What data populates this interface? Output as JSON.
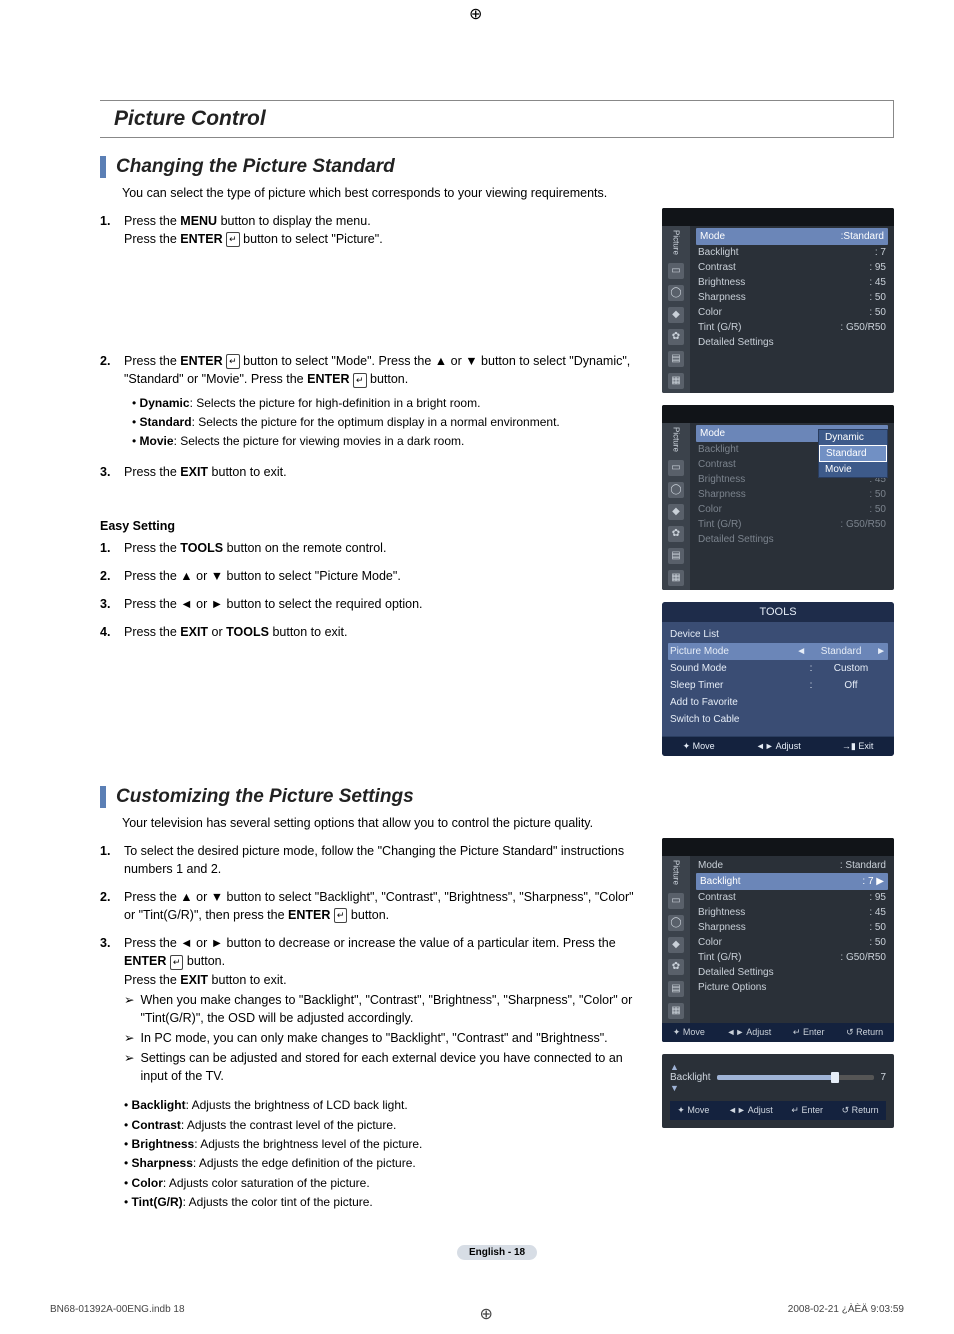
{
  "section_title": "Picture Control",
  "sub1": {
    "title": "Changing the Picture Standard",
    "intro": "You can select the type of picture which best corresponds to your viewing requirements.",
    "steps": {
      "s1a": "Press the ",
      "s1b": "MENU",
      "s1c": " button to display the menu.",
      "s1d": "Press the ",
      "s1e": "ENTER",
      "s1f": " button to select \"Picture\".",
      "s2a": "Press the ",
      "s2b": "ENTER",
      "s2c": " button to select \"Mode\". Press the ▲ or ▼ button to select \"Dynamic\", \"Standard\" or \"Movie\". Press the ",
      "s2d": "ENTER",
      "s2e": " button.",
      "dyn_l": "Dynamic",
      "dyn_d": ": Selects the picture for high-definition in a bright room.",
      "std_l": "Standard",
      "std_d": ": Selects the picture for the optimum display in a normal environment.",
      "mov_l": "Movie",
      "mov_d": ": Selects the picture for viewing movies in a dark room.",
      "s3a": "Press the ",
      "s3b": "EXIT",
      "s3c": " button to exit."
    },
    "easy_title": "Easy Setting",
    "easy": {
      "e1a": "Press the ",
      "e1b": "TOOLS",
      "e1c": " button on the remote control.",
      "e2": "Press the ▲ or ▼ button to select \"Picture Mode\".",
      "e3": "Press the ◄ or ► button to select the required option.",
      "e4a": "Press the ",
      "e4b": "EXIT",
      "e4c": " or ",
      "e4d": "TOOLS",
      "e4e": " button to exit."
    }
  },
  "osd1": {
    "side": "Picture",
    "rows": [
      {
        "k": "Mode",
        "v": ":Standard",
        "hl": true
      },
      {
        "k": "Backlight",
        "v": ": 7"
      },
      {
        "k": "Contrast",
        "v": ": 95"
      },
      {
        "k": "Brightness",
        "v": ": 45"
      },
      {
        "k": "Sharpness",
        "v": ": 50"
      },
      {
        "k": "Color",
        "v": ": 50"
      },
      {
        "k": "Tint (G/R)",
        "v": ": G50/R50"
      },
      {
        "k": "Detailed Settings",
        "v": ""
      }
    ]
  },
  "osd2": {
    "side": "Picture",
    "rows": [
      {
        "k": "Mode",
        "v": "",
        "hl": true
      },
      {
        "k": "Backlight",
        "v": ""
      },
      {
        "k": "Contrast",
        "v": ""
      },
      {
        "k": "Brightness",
        "v": ": 45"
      },
      {
        "k": "Sharpness",
        "v": ": 50"
      },
      {
        "k": "Color",
        "v": ": 50"
      },
      {
        "k": "Tint (G/R)",
        "v": ": G50/R50"
      },
      {
        "k": "Detailed Settings",
        "v": ""
      }
    ],
    "popup": [
      "Dynamic",
      "Standard",
      "Movie"
    ],
    "popup_selected": "Standard"
  },
  "tools": {
    "title": "TOOLS",
    "rows": [
      {
        "k": "Device List",
        "v": "",
        "sep": ""
      },
      {
        "k": "Picture Mode",
        "v": "Standard",
        "sel": true,
        "arrows": true
      },
      {
        "k": "Sound Mode",
        "v": "Custom",
        "sep": ":"
      },
      {
        "k": "Sleep Timer",
        "v": "Off",
        "sep": ":"
      },
      {
        "k": "Add to Favorite",
        "v": ""
      },
      {
        "k": "Switch to Cable",
        "v": ""
      }
    ],
    "foot": [
      "✦ Move",
      "◄► Adjust",
      "→▮ Exit"
    ]
  },
  "sub2": {
    "title": "Customizing the Picture Settings",
    "intro": "Your television has several setting options that allow you to control the picture quality.",
    "s1": "To select the desired picture mode, follow the \"Changing the Picture Standard\" instructions numbers 1 and 2.",
    "s2a": "Press the ▲ or ▼ button to select \"Backlight\", \"Contrast\", \"Brightness\", \"Sharpness\", \"Color\" or \"Tint(G/R)\", then press the ",
    "s2b": "ENTER",
    "s2c": " button.",
    "s3a": "Press the ◄ or ► button to decrease or increase the value of a particular item. Press the ",
    "s3b": "ENTER",
    "s3c": " button.",
    "s3d": "Press the ",
    "s3e": "EXIT",
    "s3f": " button to exit.",
    "note1": "When you make changes to \"Backlight\", \"Contrast\", \"Brightness\", \"Sharpness\", \"Color\" or \"Tint(G/R)\", the OSD will be adjusted accordingly.",
    "note2": "In PC mode, you can only make changes to \"Backlight\", \"Contrast\" and \"Brightness\".",
    "note3": "Settings can be adjusted and stored for each external device you have connected to an input of the TV.",
    "defs": {
      "bl_l": "Backlight",
      "bl_d": ": Adjusts the brightness of LCD back light.",
      "co_l": "Contrast",
      "co_d": ": Adjusts the contrast level of the picture.",
      "br_l": "Brightness",
      "br_d": ": Adjusts the brightness level of the picture.",
      "sh_l": "Sharpness",
      "sh_d": ": Adjusts the edge definition of the picture.",
      "cl_l": "Color",
      "cl_d": ": Adjusts color saturation of the picture.",
      "ti_l": "Tint(G/R)",
      "ti_d": ": Adjusts the color tint of the picture."
    }
  },
  "osd3": {
    "rows": [
      {
        "k": "Mode",
        "v": ": Standard"
      },
      {
        "k": "Backlight",
        "v": ": 7",
        "hl": true,
        "arrow": true
      },
      {
        "k": "Contrast",
        "v": ": 95"
      },
      {
        "k": "Brightness",
        "v": ": 45"
      },
      {
        "k": "Sharpness",
        "v": ": 50"
      },
      {
        "k": "Color",
        "v": ": 50"
      },
      {
        "k": "Tint (G/R)",
        "v": ": G50/R50"
      },
      {
        "k": "Detailed Settings",
        "v": ""
      },
      {
        "k": "Picture Options",
        "v": ""
      }
    ],
    "foot": [
      "✦ Move",
      "◄► Adjust",
      "↵ Enter",
      "↺ Return"
    ]
  },
  "slider": {
    "label": "Backlight",
    "value": "7",
    "foot": [
      "✦ Move",
      "◄► Adjust",
      "↵ Enter",
      "↺ Return"
    ]
  },
  "pagenum": "English - 18",
  "footer_left": "BN68-01392A-00ENG.indb   18",
  "footer_right": "2008-02-21   ¿ÀÈÄ 9:03:59"
}
